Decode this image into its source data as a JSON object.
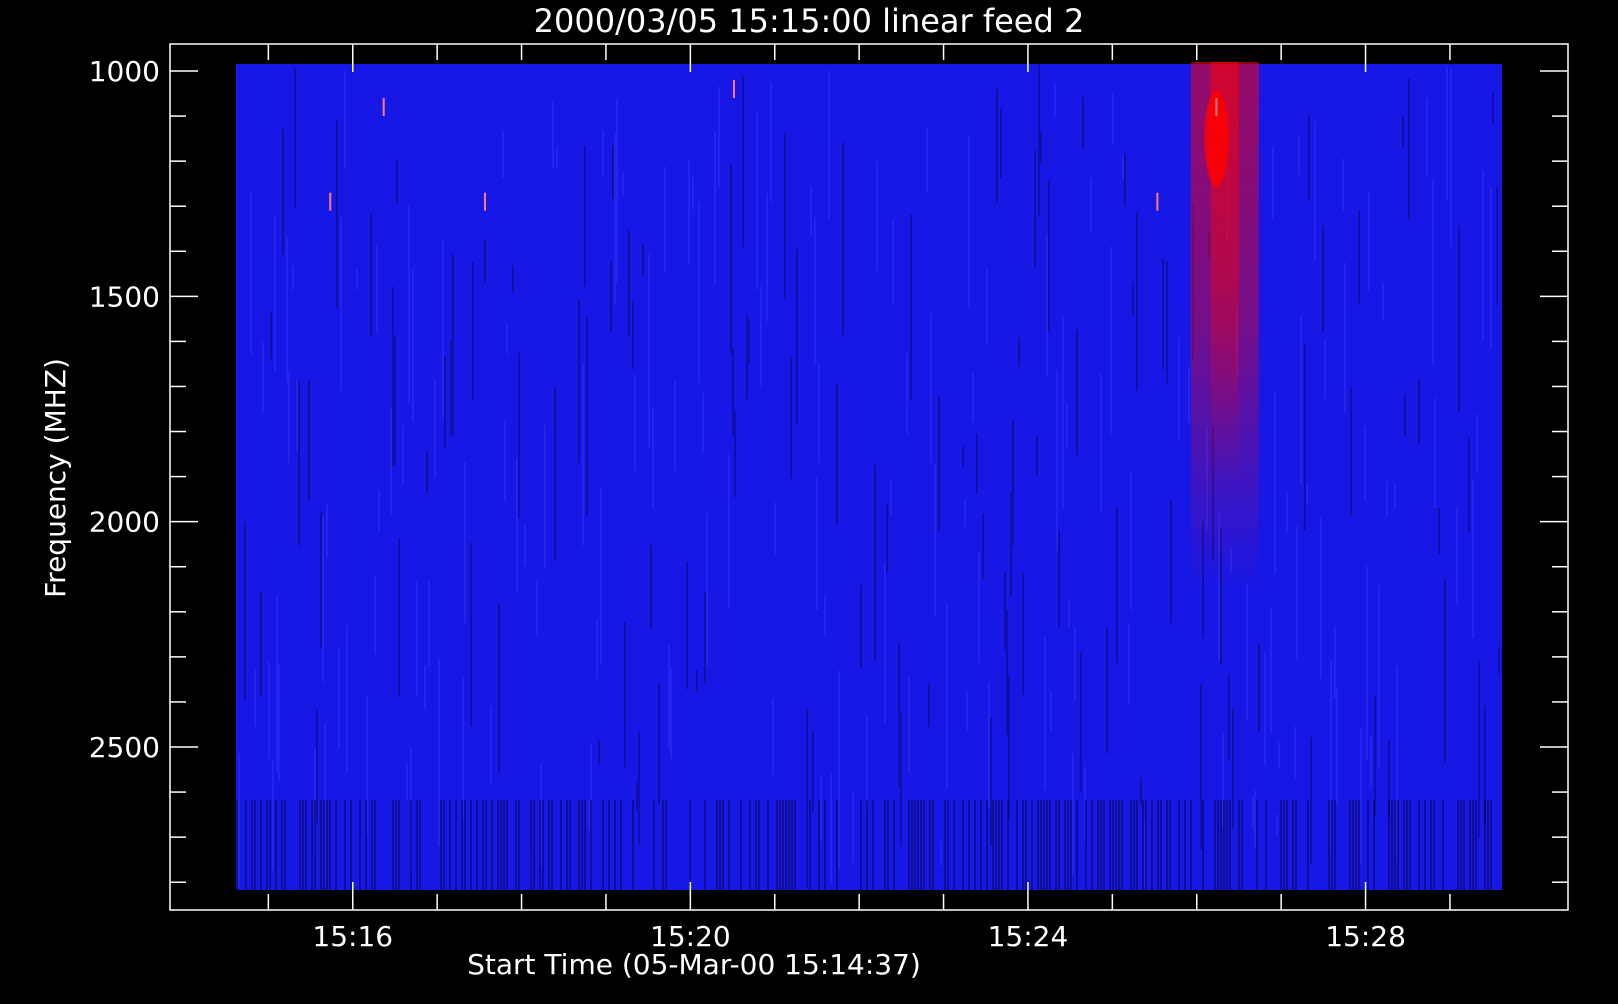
{
  "chart_data": {
    "type": "heatmap",
    "title": "2000/03/05 15:15:00 linear feed 2",
    "xlabel": "Start Time (05-Mar-00 15:14:37)",
    "ylabel": "Frequency (MHZ)",
    "x_range": [
      "15:14:37",
      "15:29:37"
    ],
    "y_range_mhz": [
      980,
      2820
    ],
    "y_axis_inverted": true,
    "x_major_ticks": [
      "15:16",
      "15:20",
      "15:24",
      "15:28"
    ],
    "y_major_ticks": [
      1000,
      1500,
      2000,
      2500
    ],
    "colormap": [
      "#000000",
      "#1414ff",
      "#ff0000"
    ],
    "background": "#1818e6",
    "burst": {
      "center_time": "15:26:20",
      "peak_time": "15:26:14",
      "peak_frequency_mhz": 1150,
      "extent_frequency_mhz": [
        980,
        2150
      ]
    },
    "spikes": [
      {
        "time": "15:15:44",
        "freq_mhz": 1290
      },
      {
        "time": "15:16:22",
        "freq_mhz": 1080
      },
      {
        "time": "15:17:34",
        "freq_mhz": 1290
      },
      {
        "time": "15:20:31",
        "freq_mhz": 1040
      },
      {
        "time": "15:25:32",
        "freq_mhz": 1290
      },
      {
        "time": "15:26:14",
        "freq_mhz": 1080
      }
    ]
  }
}
